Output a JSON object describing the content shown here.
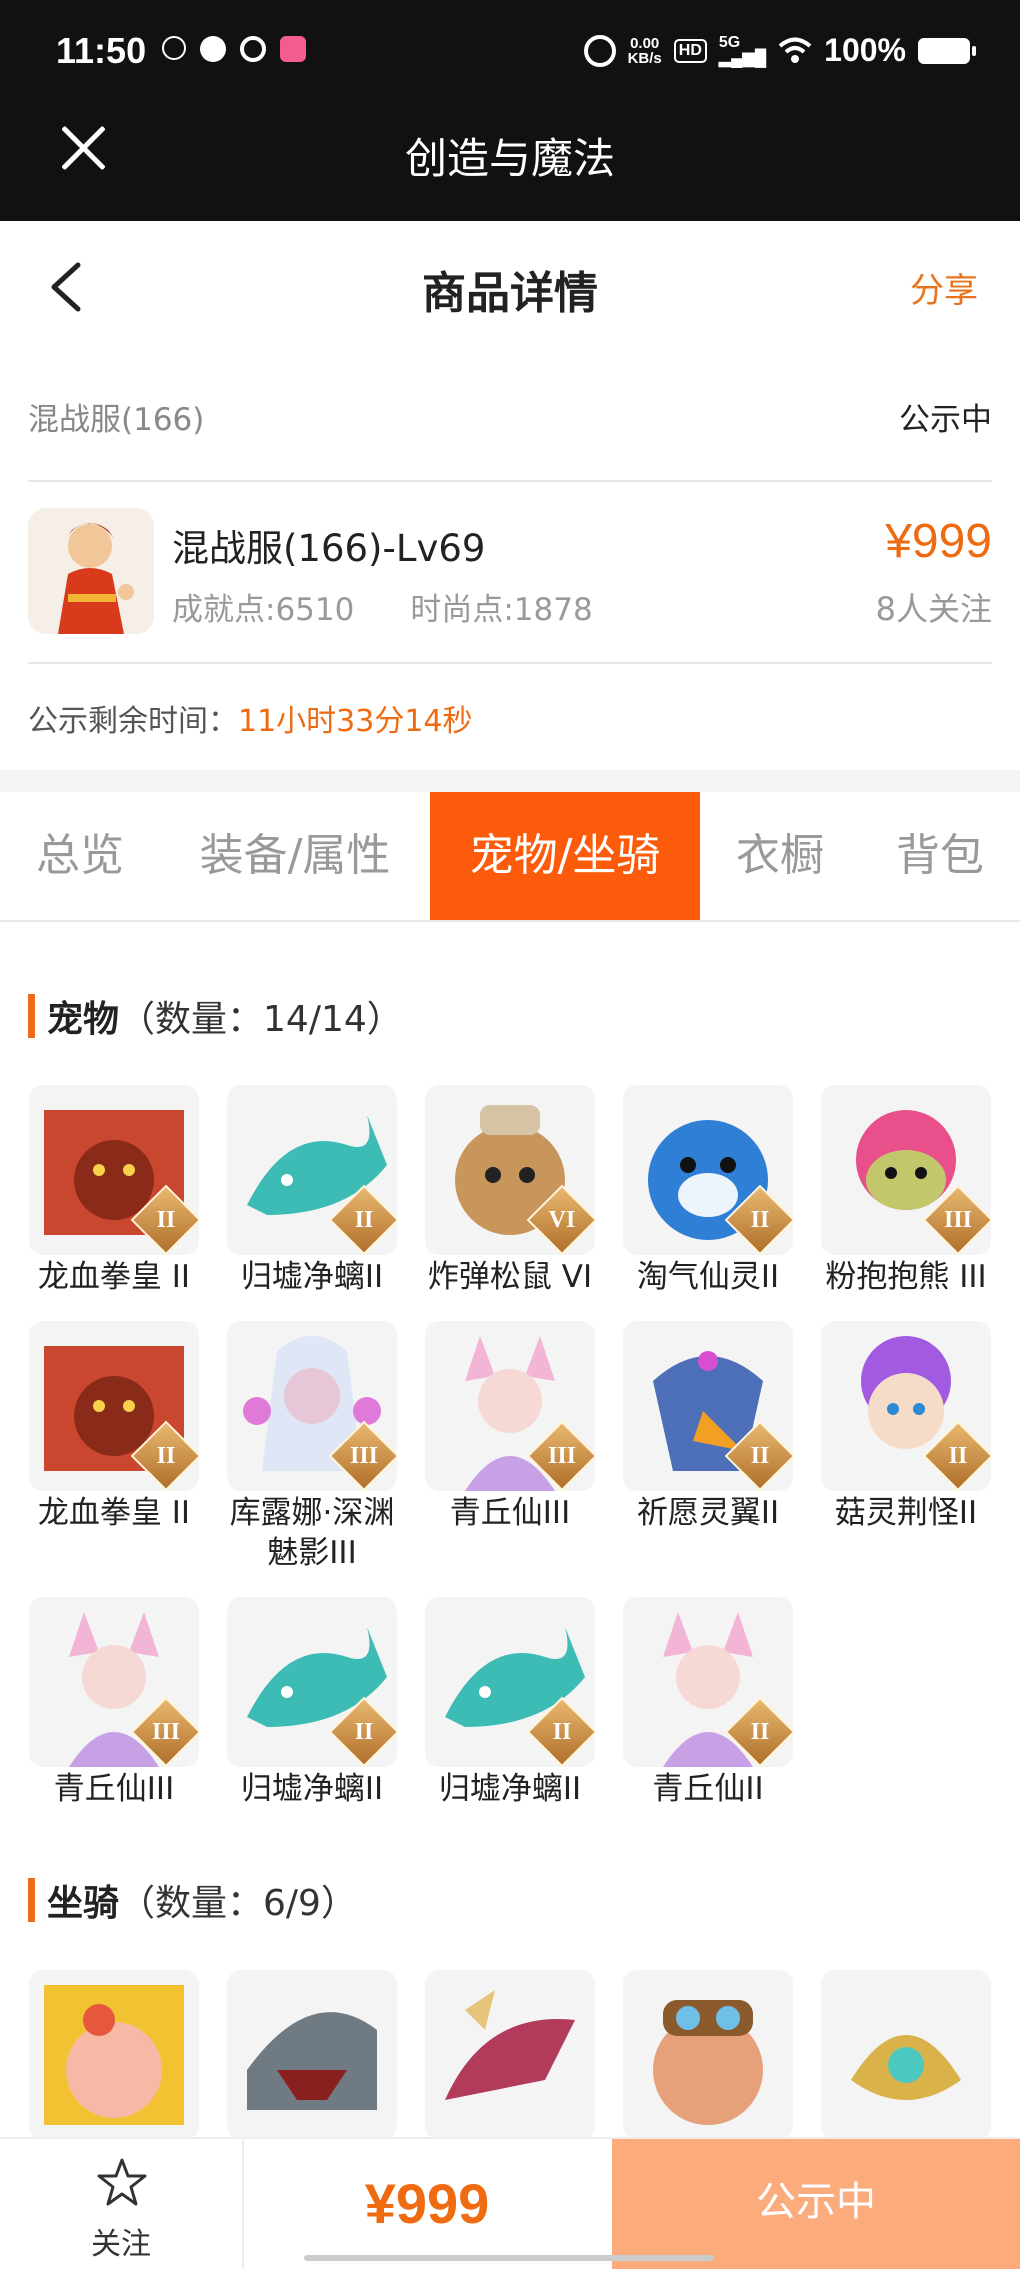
{
  "status_bar": {
    "time": "11:50",
    "net_speed_value": "0.00",
    "net_speed_unit": "KB/s",
    "hd": "HD",
    "signal": "5G",
    "battery": "100%"
  },
  "app": {
    "title": "创造与魔法"
  },
  "header": {
    "title": "商品详情",
    "share": "分享"
  },
  "server": {
    "name": "混战服(166)",
    "status": "公示中"
  },
  "product": {
    "name": "混战服(166)-Lv69",
    "achievement": "成就点:6510",
    "fashion": "时尚点:1878",
    "price": "¥999",
    "followers": "8人关注"
  },
  "remaining": {
    "label": "公示剩余时间：",
    "value": "11小时33分14秒"
  },
  "tabs": [
    {
      "label": "总览"
    },
    {
      "label": "装备/属性"
    },
    {
      "label": "宠物/坐骑"
    },
    {
      "label": "衣橱"
    },
    {
      "label": "背包"
    }
  ],
  "pets": {
    "title": "宠物",
    "count": "（数量：14/14）",
    "items": [
      {
        "name": "龙血拳皇 II",
        "rank": "II"
      },
      {
        "name": "归墟净螭II",
        "rank": "II"
      },
      {
        "name": "炸弹松鼠 VI",
        "rank": "VI"
      },
      {
        "name": "淘气仙灵II",
        "rank": "II"
      },
      {
        "name": "粉抱抱熊 III",
        "rank": "III"
      },
      {
        "name": "龙血拳皇 II",
        "rank": "II"
      },
      {
        "name": "库露娜·深渊魅影III",
        "rank": "III"
      },
      {
        "name": "青丘仙III",
        "rank": "III"
      },
      {
        "name": "祈愿灵翼II",
        "rank": "II"
      },
      {
        "name": "菇灵荆怪II",
        "rank": "II"
      },
      {
        "name": "青丘仙III",
        "rank": "III"
      },
      {
        "name": "归墟净螭II",
        "rank": "II"
      },
      {
        "name": "归墟净螭II",
        "rank": "II"
      },
      {
        "name": "青丘仙II",
        "rank": "II"
      }
    ]
  },
  "mounts": {
    "title": "坐骑",
    "count": "（数量：6/9）"
  },
  "bottom": {
    "follow": "关注",
    "price": "¥999",
    "status": "公示中"
  },
  "colors": {
    "accent": "#ef6b12",
    "tab_active": "#fb5b0a",
    "cta": "#fbab7c"
  }
}
